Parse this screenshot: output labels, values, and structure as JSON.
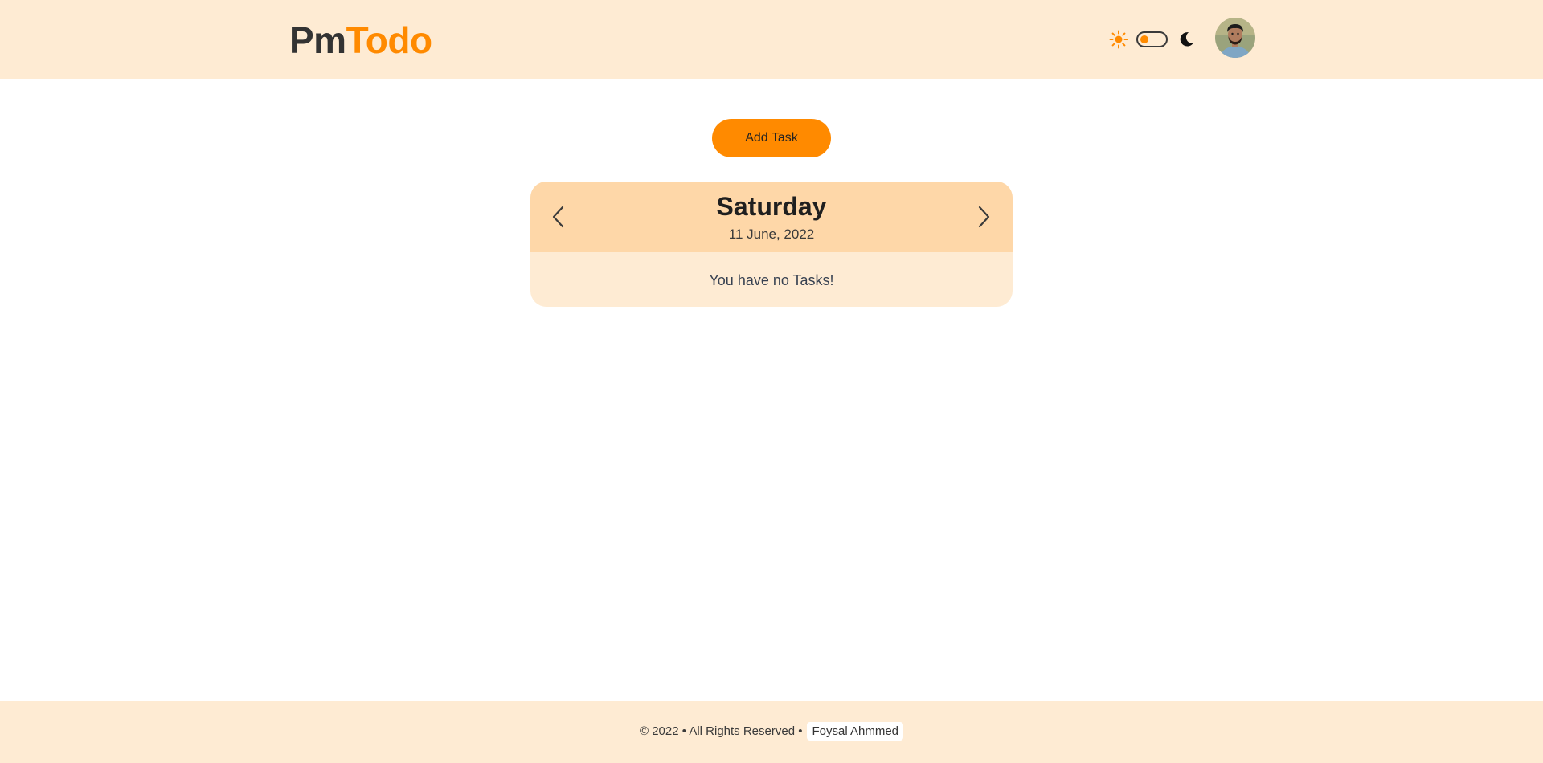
{
  "header": {
    "logo_part1": "Pm",
    "logo_part2": "Todo",
    "theme_toggle": {
      "mode": "light",
      "accent": "#ff8a00"
    },
    "icons": [
      "sun-icon",
      "moon-icon"
    ],
    "avatar": "user-avatar"
  },
  "main": {
    "add_button_label": "Add Task",
    "card": {
      "day": "Saturday",
      "date": "11 June, 2022",
      "empty_message": "You have no Tasks!",
      "prev_icon": "chevron-left-icon",
      "next_icon": "chevron-right-icon"
    }
  },
  "footer": {
    "copyright": "© 2022 • All Rights Reserved •",
    "author": "Foysal Ahmmed"
  },
  "colors": {
    "accent": "#ff8a00",
    "header_bg": "#feebd3",
    "card_head_bg": "#fed7a8",
    "card_body_bg": "#feebd3"
  }
}
